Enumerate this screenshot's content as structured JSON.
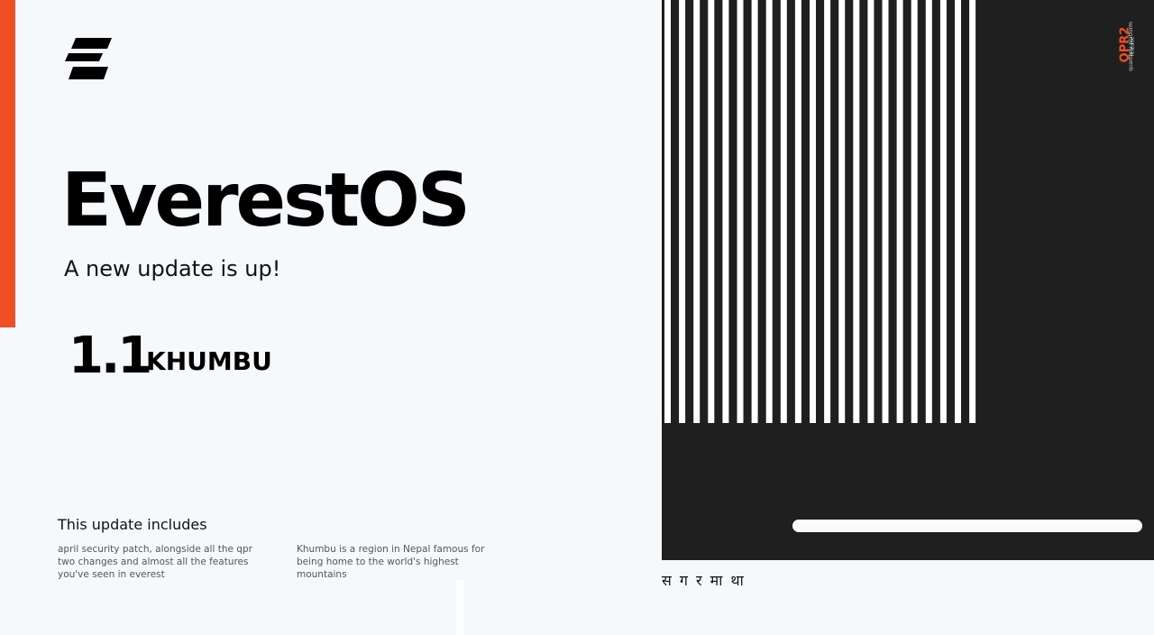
{
  "brand": {
    "logo_icon": "everest-e-logo-icon",
    "accent_color": "#f04e23",
    "dark_color": "#1f1f1f",
    "background_color": "#f5f9fc"
  },
  "hero": {
    "title": "EverestOS",
    "subtitle": "A new update is up!"
  },
  "release": {
    "version": "1.1",
    "codename": "KHUMBU"
  },
  "details": {
    "heading": "This update includes",
    "left_text": "april security patch, alongside all  the qpr two changes and almost all the features you've seen in everest",
    "right_text": "Khumbu is a region in Nepal famous for being home to the world's highest mountains"
  },
  "badge": {
    "title": "QPR2",
    "line1": "quarterly platform",
    "line2": "release"
  },
  "nepali_text": "स ग र मा था"
}
